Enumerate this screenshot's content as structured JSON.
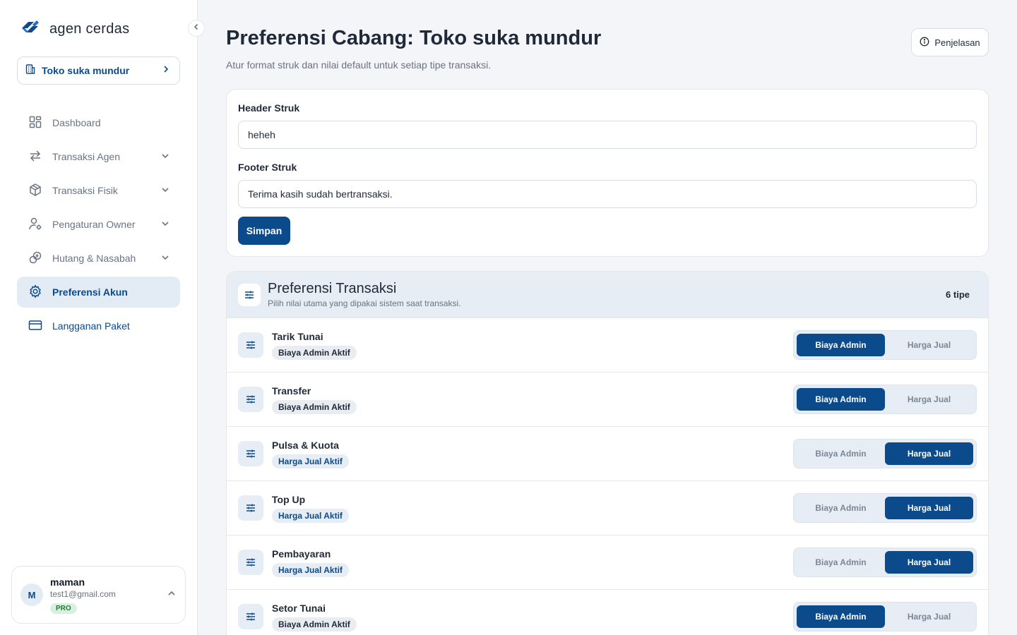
{
  "brand": {
    "name": "agen cerdas",
    "accent": "#0b4a8b"
  },
  "branch": {
    "name": "Toko suka mundur"
  },
  "nav": [
    {
      "label": "Dashboard",
      "icon": "dashboard-icon",
      "chevron": false,
      "state": "normal"
    },
    {
      "label": "Transaksi Agen",
      "icon": "swap-icon",
      "chevron": true,
      "state": "normal"
    },
    {
      "label": "Transaksi Fisik",
      "icon": "box-icon",
      "chevron": true,
      "state": "normal"
    },
    {
      "label": "Pengaturan Owner",
      "icon": "user-cog-icon",
      "chevron": true,
      "state": "normal"
    },
    {
      "label": "Hutang & Nasabah",
      "icon": "coins-icon",
      "chevron": true,
      "state": "normal"
    },
    {
      "label": "Preferensi Akun",
      "icon": "gear-icon",
      "chevron": false,
      "state": "active"
    },
    {
      "label": "Langganan Paket",
      "icon": "credit-card-icon",
      "chevron": false,
      "state": "accent"
    }
  ],
  "user": {
    "initial": "M",
    "name": "maman",
    "email": "test1@gmail.com",
    "plan": "PRO"
  },
  "page": {
    "title": "Preferensi Cabang: Toko suka mundur",
    "subtitle": "Atur format struk dan nilai default untuk setiap tipe transaksi.",
    "explain_label": "Penjelasan"
  },
  "receipt": {
    "header_label": "Header Struk",
    "header_value": "heheh",
    "footer_label": "Footer Struk",
    "footer_value": "Terima kasih sudah bertransaksi.",
    "save_label": "Simpan"
  },
  "preferences": {
    "title": "Preferensi Transaksi",
    "subtitle": "Pilih nilai utama yang dipakai sistem saat transaksi.",
    "count": "6 tipe",
    "option_admin": "Biaya Admin",
    "option_jual": "Harga Jual",
    "rows": [
      {
        "name": "Tarik Tunai",
        "badge": "Biaya Admin Aktif",
        "selected": "admin"
      },
      {
        "name": "Transfer",
        "badge": "Biaya Admin Aktif",
        "selected": "admin"
      },
      {
        "name": "Pulsa & Kuota",
        "badge": "Harga Jual Aktif",
        "selected": "jual"
      },
      {
        "name": "Top Up",
        "badge": "Harga Jual Aktif",
        "selected": "jual"
      },
      {
        "name": "Pembayaran",
        "badge": "Harga Jual Aktif",
        "selected": "jual"
      },
      {
        "name": "Setor Tunai",
        "badge": "Biaya Admin Aktif",
        "selected": "admin"
      }
    ]
  }
}
